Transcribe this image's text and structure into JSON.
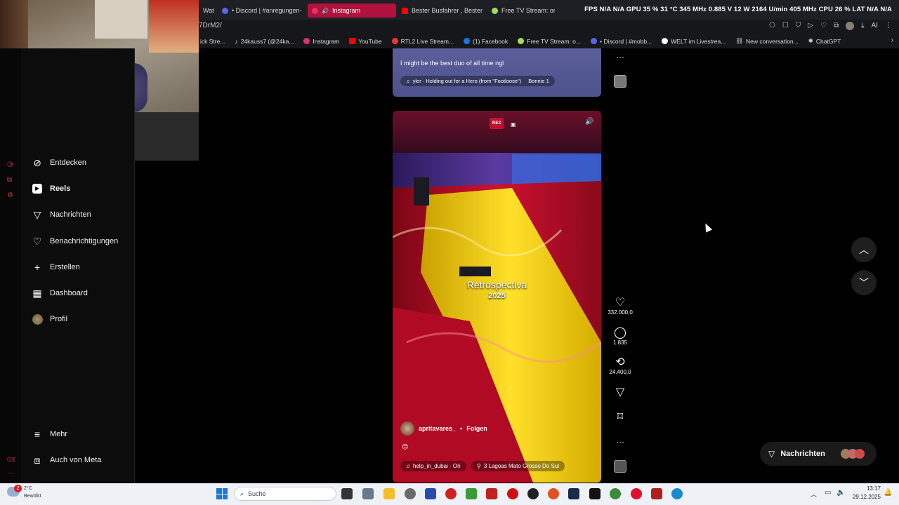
{
  "browser": {
    "tabs": [
      {
        "label": "Wat",
        "color": "#888888"
      },
      {
        "label": "• Discord | #anregungen-",
        "color": "#5865f2"
      },
      {
        "label": "Instagram",
        "color": "#e1306c",
        "active": true
      },
      {
        "label": "Bester Busfahrer , Bester",
        "color": "#ff0000"
      },
      {
        "label": "Free TV Stream: online",
        "color": "#9be15d"
      }
    ],
    "stats": "FPS N/A  N/A    GPU 35 %  31 °C  345 MHz  0.885 V  12 W  2164 U/min  405 MHz    CPU 26 %    LAT N/A  N/A",
    "url": "7DrM2/",
    "nav_icons": [
      "bookmark-icon",
      "square-icon",
      "shield-icon",
      "play-icon",
      "heart-icon",
      "extensions-icon",
      "download-icon",
      "ai-icon",
      "menu-icon"
    ],
    "ai_label": "AI",
    "bookmarks": [
      {
        "label": "ick Stre...",
        "color": "#888888"
      },
      {
        "label": "24kauss7 (@24ka...",
        "color": "#ffffff"
      },
      {
        "label": "Instagram",
        "color": "#e1306c"
      },
      {
        "label": "YouTube",
        "color": "#ff0000"
      },
      {
        "label": "RTL2 Live Stream...",
        "color": "#ee3333"
      },
      {
        "label": "(1) Facebook",
        "color": "#1877f2"
      },
      {
        "label": "Free TV Stream: o...",
        "color": "#9be15d"
      },
      {
        "label": "• Discord | #mobb...",
        "color": "#5865f2"
      },
      {
        "label": "WELT im Livestrea...",
        "color": "#ffffff"
      },
      {
        "label": "New conversation...",
        "color": "#ffffff"
      },
      {
        "label": "ChatGPT",
        "color": "#cccccc"
      }
    ]
  },
  "sidebar": {
    "items": [
      {
        "label": "Entdecken",
        "icon": "compass-icon"
      },
      {
        "label": "Reels",
        "icon": "reels-icon"
      },
      {
        "label": "Nachrichten",
        "icon": "send-icon"
      },
      {
        "label": "Benachrichtigungen",
        "icon": "heart-icon"
      },
      {
        "label": "Erstellen",
        "icon": "plus-icon"
      },
      {
        "label": "Dashboard",
        "icon": "dashboard-icon"
      },
      {
        "label": "Profil",
        "icon": "avatar"
      }
    ],
    "bottom": [
      {
        "label": "Mehr",
        "icon": "menu-icon"
      },
      {
        "label": "Auch von Meta",
        "icon": "meta-icon"
      }
    ]
  },
  "reel_prev": {
    "caption": "I might be the best duo of all time ngl",
    "audio": "yler · Holding out for a Hero (from \"Footloose\")",
    "audio_user": "Bonnie 1"
  },
  "reel": {
    "badge": "REX",
    "overlay_title": "Retrospectiva",
    "overlay_year": "2025",
    "username": "apritavares_",
    "separator": "•",
    "follow": "Folgen",
    "audio": "help_in_dubai · Ori",
    "location": "3 Lagoas Mato Grosso Do Sul",
    "likes": "332.000,0",
    "comments": "1.835",
    "reposts": "24.400,0"
  },
  "messages_button": "Nachrichten",
  "taskbar": {
    "weather_temp": "2°C",
    "weather_desc": "Bewölkt",
    "notification_count": "2",
    "search": "Suche",
    "time": "13:17",
    "date": "29.12.2025"
  },
  "colors": {
    "active_tab": "#b0123d",
    "sidebar_bg": "#0c0c0c",
    "reel_prev_bg": "#5b5e9a",
    "slide_red": "#c8102e",
    "slide_yellow": "#f5d000"
  }
}
